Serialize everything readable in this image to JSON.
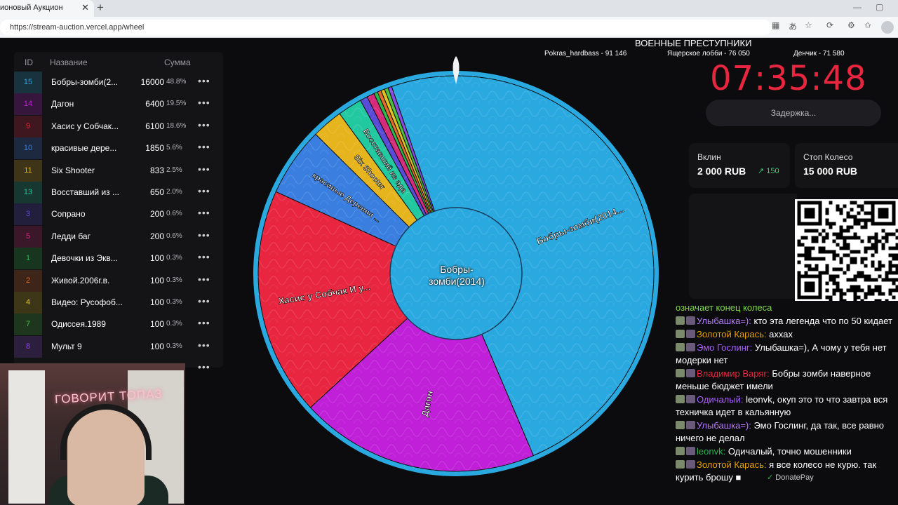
{
  "browser": {
    "tab_title": "ионовый Аукцион",
    "url": "https://stream-auction.vercel.app/wheel"
  },
  "table": {
    "headers": {
      "id": "ID",
      "name": "Название",
      "sum": "Сумма"
    },
    "rows": [
      {
        "id": "15",
        "name": "Бобры-зомби(2...",
        "sum": "16000",
        "pct": "48.8%",
        "color": "#2aa9e0"
      },
      {
        "id": "14",
        "name": "Дагон",
        "sum": "6400",
        "pct": "19.5%",
        "color": "#c020d8"
      },
      {
        "id": "9",
        "name": "Хасис у Собчак...",
        "sum": "6100",
        "pct": "18.6%",
        "color": "#e8263f"
      },
      {
        "id": "10",
        "name": "красивые дере...",
        "sum": "1850",
        "pct": "5.6%",
        "color": "#3a7fe0"
      },
      {
        "id": "11",
        "name": "Six Shooter",
        "sum": "833",
        "pct": "2.5%",
        "color": "#e6b41c"
      },
      {
        "id": "13",
        "name": "Восставший из ...",
        "sum": "650",
        "pct": "2.0%",
        "color": "#22c9a0"
      },
      {
        "id": "3",
        "name": "Сопрано",
        "sum": "200",
        "pct": "0.6%",
        "color": "#5a4ad8"
      },
      {
        "id": "5",
        "name": "Ледди баг",
        "sum": "200",
        "pct": "0.6%",
        "color": "#d62a7a"
      },
      {
        "id": "1",
        "name": "Девочки из Экв...",
        "sum": "100",
        "pct": "0.3%",
        "color": "#2ab84a"
      },
      {
        "id": "2",
        "name": "Живой.2006г.в.",
        "sum": "100",
        "pct": "0.3%",
        "color": "#e06a2a"
      },
      {
        "id": "4",
        "name": "Видео: Русофоб...",
        "sum": "100",
        "pct": "0.3%",
        "color": "#e0c020"
      },
      {
        "id": "7",
        "name": "Одиссея.1989",
        "sum": "100",
        "pct": "0.3%",
        "color": "#4ac040"
      },
      {
        "id": "8",
        "name": "Мульт 9",
        "sum": "100",
        "pct": "0.3%",
        "color": "#8a4ae0"
      }
    ],
    "more_icon": "•••"
  },
  "header": {
    "title": "ВОЕННЫЕ ПРЕСТУПНИКИ",
    "donors": [
      "Pokras_hardbass - 91 146",
      "Ящерское лобби - 76 050",
      "Денчик - 71 580"
    ]
  },
  "timer": {
    "value": "07:35:48",
    "delay_label": "Задержка..."
  },
  "cards": {
    "vklin_label": "Вклин",
    "vklin_value": "2 000 RUB",
    "vklin_inc": "150",
    "stop_label": "Стоп Колесо",
    "stop_value": "15 000 RUB"
  },
  "wheel": {
    "center_label": "Бобры-зомби(2014)",
    "segments": [
      {
        "label": "Бобры-зомби(2014...",
        "value": 16000,
        "color": "#2aa9e0"
      },
      {
        "label": "Дагон",
        "value": 6400,
        "color": "#c020d8"
      },
      {
        "label": "Хасис у Собчак И у...",
        "value": 6100,
        "color": "#e8263f"
      },
      {
        "label": "красивые Деревни ...",
        "value": 1850,
        "color": "#3a7fe0"
      },
      {
        "label": "Six Shooter",
        "value": 833,
        "color": "#e6b41c"
      },
      {
        "label": "Восставший из ада",
        "value": 650,
        "color": "#22c9a0"
      }
    ]
  },
  "chat": {
    "intro": "означает конец колеса",
    "messages": [
      {
        "user": "Улыбашка=)",
        "color": "#b57cff",
        "text": "кто эта легенда что по 50 кидает"
      },
      {
        "user": "Золотой Карась",
        "color": "#e8a000",
        "text": "аххах"
      },
      {
        "user": "Эмо Гослинг",
        "color": "#a960ff",
        "text": "Улыбашка=), А чому у тебя нет модерки нет"
      },
      {
        "user": "Владимир Варяг",
        "color": "#e8263f",
        "text": "Бобры зомби наверное меньше бюджет имели"
      },
      {
        "user": "Одичалый",
        "color": "#a960ff",
        "text": "leonvk, окуп это то что завтра вся техничка идет в кальянную"
      },
      {
        "user": "Улыбашка=)",
        "color": "#b57cff",
        "text": "Эмо Гослинг, да так, все равно ничего не делал"
      },
      {
        "user": "leonvk",
        "color": "#2ab84a",
        "text": "Одичалый, точно мошенники"
      },
      {
        "user": "Золотой Карась",
        "color": "#e8a000",
        "text": "я все колесо не курю. так курить брошу ■"
      }
    ],
    "donatepay": "DonatePay"
  },
  "webcam": {
    "neon_text": "ГОВОРИТ ТОПАЗ"
  }
}
